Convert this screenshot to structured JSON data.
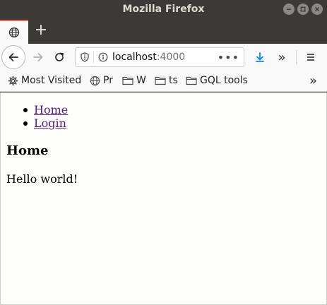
{
  "window": {
    "title": "Mozilla Firefox",
    "controls": [
      "minimize",
      "maximize",
      "close"
    ]
  },
  "tabs": {
    "new_tab_label": "+"
  },
  "navbar": {
    "url_host": "localhost",
    "url_port": ":4000",
    "more_label": "•••",
    "overflow_label": "»"
  },
  "bookmarks": {
    "items": [
      {
        "label": "Most Visited",
        "icon": "gear-icon"
      },
      {
        "label": "Pr",
        "icon": "globe-icon"
      },
      {
        "label": "W",
        "icon": "folder-icon"
      },
      {
        "label": "ts",
        "icon": "folder-icon"
      },
      {
        "label": "GQL tools",
        "icon": "folder-icon"
      }
    ],
    "overflow_label": "»"
  },
  "page": {
    "nav_links": [
      "Home",
      "Login"
    ],
    "heading": "Home",
    "body_text": "Hello world!"
  },
  "colors": {
    "link": "#551a8b",
    "tab_accent": "#e8674a",
    "download": "#0a84ff"
  }
}
